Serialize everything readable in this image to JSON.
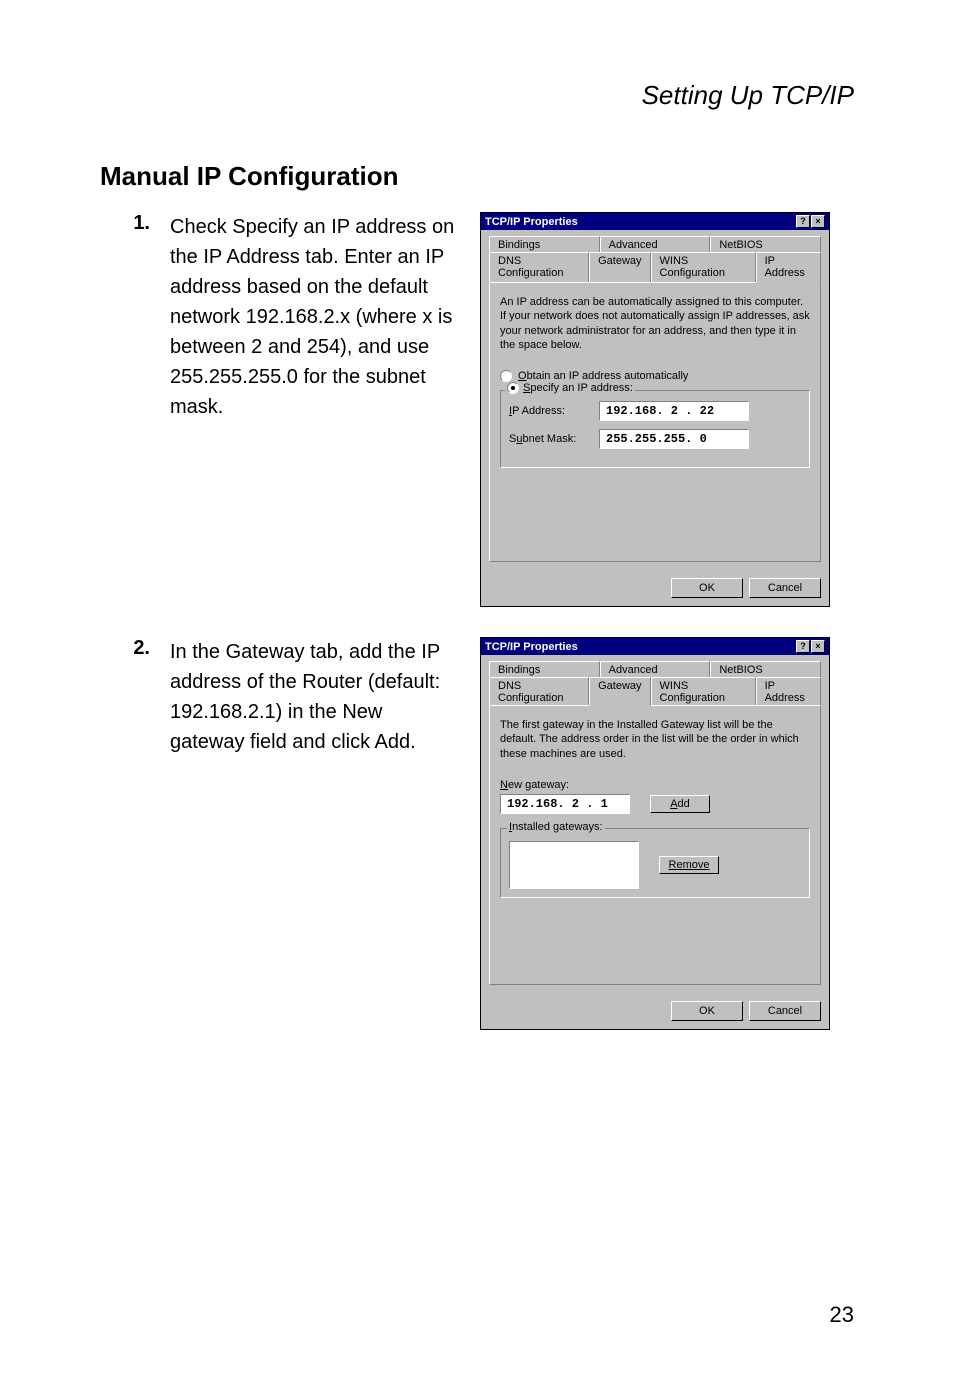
{
  "breadcrumb": "Setting Up TCP/IP",
  "heading": "Manual IP Configuration",
  "steps": [
    {
      "num": "1.",
      "text": "Check Specify an IP address on the IP Address tab. Enter an IP address based on the default network 192.168.2.x (where x is between 2 and 254), and use 255.255.255.0 for the subnet mask."
    },
    {
      "num": "2.",
      "text": "In the Gateway tab, add the IP address of the Router (default: 192.168.2.1) in the New gateway field and click Add."
    }
  ],
  "dialog1": {
    "title": "TCP/IP Properties",
    "tabs_row1": [
      "Bindings",
      "Advanced",
      "NetBIOS"
    ],
    "tabs_row2": [
      "DNS Configuration",
      "Gateway",
      "WINS Configuration",
      "IP Address"
    ],
    "desc": "An IP address can be automatically assigned to this computer. If your network does not automatically assign IP addresses, ask your network administrator for an address, and then type it in the space below.",
    "radio_auto": "Obtain an IP address automatically",
    "radio_specify": "Specify an IP address:",
    "ip_label": "IP Address:",
    "ip_value": "192.168. 2 . 22",
    "subnet_label": "Subnet Mask:",
    "subnet_value": "255.255.255. 0",
    "ok": "OK",
    "cancel": "Cancel"
  },
  "dialog2": {
    "title": "TCP/IP Properties",
    "tabs_row1": [
      "Bindings",
      "Advanced",
      "NetBIOS"
    ],
    "tabs_row2": [
      "DNS Configuration",
      "Gateway",
      "WINS Configuration",
      "IP Address"
    ],
    "desc": "The first gateway in the Installed Gateway list will be the default. The address order in the list will be the order in which these machines are used.",
    "new_gateway_label": "New gateway:",
    "new_gateway_value": "192.168. 2 . 1",
    "add": "Add",
    "installed_label": "Installed gateways:",
    "remove": "Remove",
    "ok": "OK",
    "cancel": "Cancel"
  },
  "page_number": "23"
}
